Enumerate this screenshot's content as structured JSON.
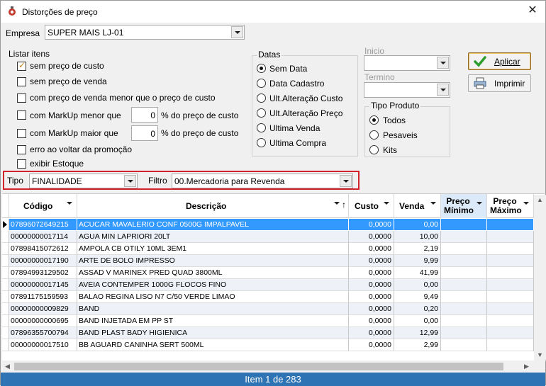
{
  "window": {
    "title": "Distorções de preço",
    "icon": "app-settings-icon",
    "close_symbol": "✕"
  },
  "empresa": {
    "label": "Empresa",
    "value": "SUPER MAIS LJ-01"
  },
  "listar": {
    "title": "Listar itens",
    "options": [
      {
        "label": "sem preço de custo",
        "checked": true
      },
      {
        "label": "sem preço de venda",
        "checked": false
      },
      {
        "label": "com preço de venda menor que o preço de custo",
        "checked": false
      }
    ],
    "markup_menor": {
      "label": "com MarkUp menor que",
      "value": "0",
      "suffix": "% do preço de custo",
      "checked": false
    },
    "markup_maior": {
      "label": "com MarkUp maior que",
      "value": "0",
      "suffix": "% do preço de custo",
      "checked": false
    },
    "erro_promocao": {
      "label": "erro ao voltar da promoção",
      "checked": false
    },
    "exibir_estoque": {
      "label": "exibir Estoque",
      "checked": false
    }
  },
  "datas": {
    "title": "Datas",
    "options": [
      "Sem Data",
      "Data Cadastro",
      "Ult.Alteração Custo",
      "Ult.Alteração Preço",
      "Ultima Venda",
      "Ultima Compra"
    ],
    "selected_index": 0
  },
  "inicio": {
    "label": "Inicio",
    "value": ""
  },
  "termino": {
    "label": "Termino",
    "value": ""
  },
  "tipo_produto": {
    "title": "Tipo Produto",
    "options": [
      "Todos",
      "Pesaveis",
      "Kits"
    ],
    "selected_index": 0
  },
  "buttons": {
    "aplicar": "Aplicar",
    "imprimir": "Imprimir"
  },
  "filter_bar": {
    "tipo_label": "Tipo",
    "tipo_value": "FINALIDADE",
    "filtro_label": "Filtro",
    "filtro_value": "00.Mercadoria para Revenda"
  },
  "grid": {
    "columns": {
      "codigo": "Código",
      "descricao": "Descrição",
      "custo": "Custo",
      "venda": "Venda",
      "preco_minimo": [
        "Preço",
        "Mínimo"
      ],
      "preco_maximo": [
        "Preço",
        "Máximo"
      ]
    },
    "rows": [
      {
        "codigo": "07896072649215",
        "descricao": "ACUCAR MAVALERIO CONF 0500G IMPALPAVEL",
        "custo": "0,0000",
        "venda": "0,00"
      },
      {
        "codigo": "00000000017114",
        "descricao": "AGUA MIN LAPRIORI 20LT",
        "custo": "0,0000",
        "venda": "10,00"
      },
      {
        "codigo": "07898415072612",
        "descricao": "AMPOLA CB OTILY 10ML 3EM1",
        "custo": "0,0000",
        "venda": "2,19"
      },
      {
        "codigo": "00000000017190",
        "descricao": "ARTE DE BOLO IMPRESSO",
        "custo": "0,0000",
        "venda": "9,99"
      },
      {
        "codigo": "07894993129502",
        "descricao": "ASSAD V MARINEX PRED QUAD 3800ML",
        "custo": "0,0000",
        "venda": "41,99"
      },
      {
        "codigo": "00000000017145",
        "descricao": "AVEIA CONTEMPER 1000G FLOCOS FINO",
        "custo": "0,0000",
        "venda": "0,00"
      },
      {
        "codigo": "07891175159593",
        "descricao": "BALAO REGINA LISO N7 C/50 VERDE LIMAO",
        "custo": "0,0000",
        "venda": "9,49"
      },
      {
        "codigo": "00000000009829",
        "descricao": "BAND",
        "custo": "0,0000",
        "venda": "0,20"
      },
      {
        "codigo": "00000000000695",
        "descricao": "BAND INJETADA EM PP ST",
        "custo": "0,0000",
        "venda": "0,00"
      },
      {
        "codigo": "07896355700794",
        "descricao": "BAND PLAST BADY HIGIENICA",
        "custo": "0,0000",
        "venda": "12,99"
      },
      {
        "codigo": "00000000017510",
        "descricao": "BB AGUARD CANINHA SERT 500ML",
        "custo": "0,0000",
        "venda": "2,99"
      }
    ]
  },
  "status": {
    "text": "Item 1 de 283"
  },
  "colors": {
    "selection": "#3399ff",
    "status_bar": "#2e74b5",
    "highlight_border": "#d2232a"
  }
}
